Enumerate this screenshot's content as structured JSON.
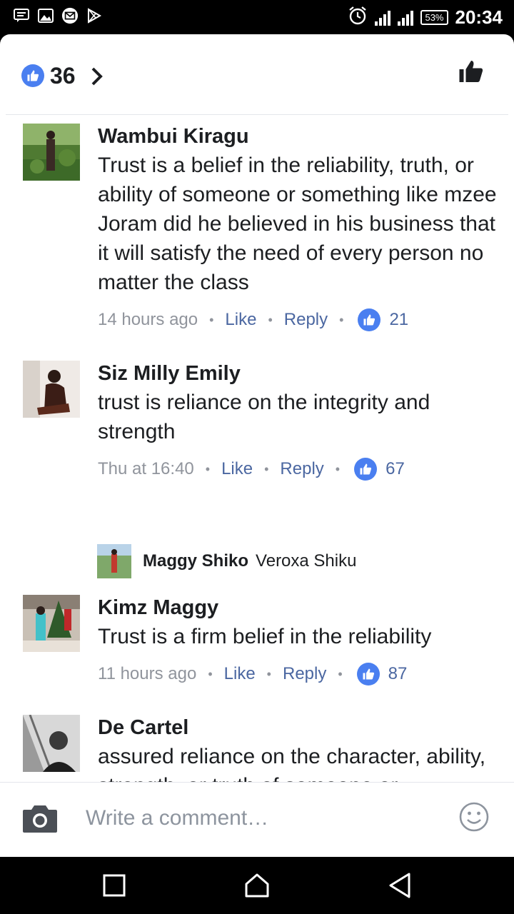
{
  "status_bar": {
    "battery": "53%",
    "time": "20:34",
    "icons": [
      "message-icon",
      "image-icon",
      "mail-icon",
      "play-store-icon",
      "alarm-icon",
      "signal-icon"
    ]
  },
  "header": {
    "reaction_count": "36",
    "icons": [
      "like-badge-icon",
      "chevron-right-icon",
      "thumbs-up-icon"
    ]
  },
  "comments": [
    {
      "name": "Wambui Kiragu",
      "text": "Trust is a belief in the reliability, truth, or ability of someone or something like mzee Joram did he believed in his business that it will satisfy  the need of every person no matter the class",
      "time": "14 hours ago",
      "like_label": "Like",
      "reply_label": "Reply",
      "likes": "21"
    },
    {
      "name": "Siz Milly Emily",
      "text": "trust is reliance on the integrity and strength",
      "time": "Thu at 16:40",
      "like_label": "Like",
      "reply_label": "Reply",
      "likes": "67"
    },
    {
      "name": "Kimz Maggy",
      "text": "Trust is a firm belief in the reliability",
      "time": "11 hours ago",
      "like_label": "Like",
      "reply_label": "Reply",
      "likes": "87"
    },
    {
      "name": "De Cartel",
      "text": "assured reliance on the character, ability, strength, or truth of someone or something #JoramKamauDay"
    }
  ],
  "reply_preview": {
    "name": "Maggy Shiko",
    "text": "Veroxa Shiku"
  },
  "composer": {
    "placeholder": "Write a comment…",
    "icons": [
      "camera-icon",
      "smiley-icon"
    ]
  },
  "colors": {
    "accent": "#4a7ff0",
    "link": "#4b67a1",
    "muted": "#90949c",
    "text": "#1c1e21"
  }
}
